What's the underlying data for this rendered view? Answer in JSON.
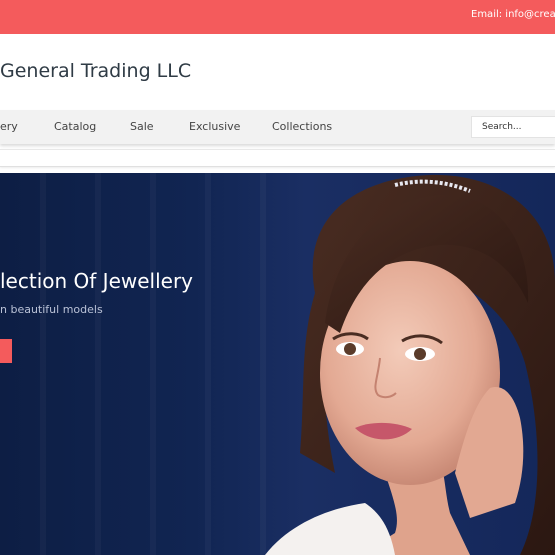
{
  "topbar": {
    "email": "Email: info@creati"
  },
  "brand": {
    "title": "General Trading LLC"
  },
  "nav": {
    "items": [
      "ery",
      "Catalog",
      "Sale",
      "Exclusive",
      "Collections"
    ],
    "search_placeholder": "Search..."
  },
  "hero": {
    "title": "lection Of Jewellery",
    "subtitle": "n beautiful models",
    "image": "girl-with-tiara-photo"
  },
  "colors": {
    "accent": "#f45b5c",
    "hero_bg": "#112552",
    "nav_bg": "#f2f2f2"
  }
}
